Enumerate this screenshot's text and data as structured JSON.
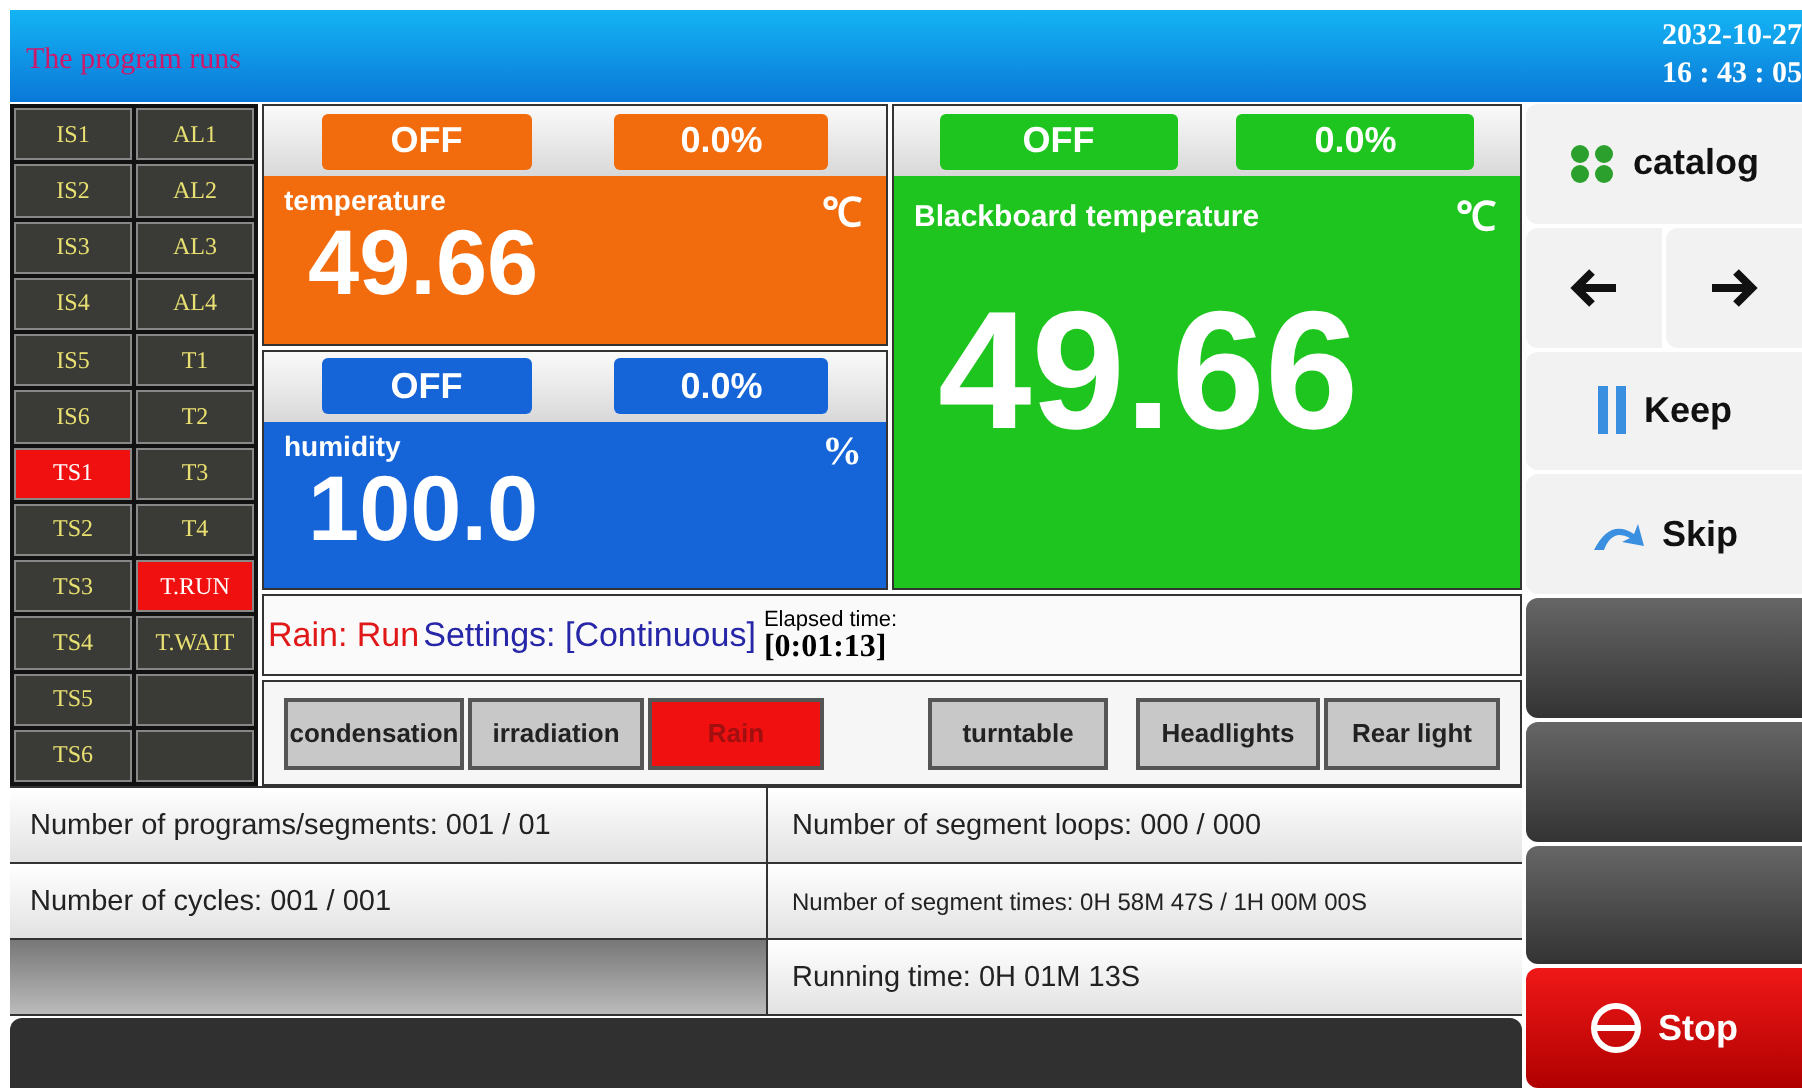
{
  "header": {
    "title": "The program runs",
    "date": "2032-10-27",
    "time": "16 : 43 : 05"
  },
  "indicators": [
    {
      "label": "IS1",
      "active": false
    },
    {
      "label": "AL1",
      "active": false
    },
    {
      "label": "IS2",
      "active": false
    },
    {
      "label": "AL2",
      "active": false
    },
    {
      "label": "IS3",
      "active": false
    },
    {
      "label": "AL3",
      "active": false
    },
    {
      "label": "IS4",
      "active": false
    },
    {
      "label": "AL4",
      "active": false
    },
    {
      "label": "IS5",
      "active": false
    },
    {
      "label": "T1",
      "active": false
    },
    {
      "label": "IS6",
      "active": false
    },
    {
      "label": "T2",
      "active": false
    },
    {
      "label": "TS1",
      "active": true
    },
    {
      "label": "T3",
      "active": false
    },
    {
      "label": "TS2",
      "active": false
    },
    {
      "label": "T4",
      "active": false
    },
    {
      "label": "TS3",
      "active": false
    },
    {
      "label": "T.RUN",
      "active": true
    },
    {
      "label": "TS4",
      "active": false
    },
    {
      "label": "T.WAIT",
      "active": false
    },
    {
      "label": "TS5",
      "active": false
    },
    {
      "active": false
    },
    {
      "label": "TS6",
      "active": false
    },
    {
      "active": false
    }
  ],
  "panels": [
    {
      "kind": "small",
      "label": "temperature",
      "unit": "℃",
      "value": "49.66",
      "status": "OFF",
      "output": "0.0%",
      "color": "#f26b0c"
    },
    {
      "kind": "small",
      "label": "humidity",
      "unit": "%",
      "value": "100.0",
      "status": "OFF",
      "output": "0.0%",
      "color": "#1565d8"
    },
    {
      "kind": "large",
      "label": "Blackboard temperature",
      "unit": "℃",
      "value": "49.66",
      "status": "OFF",
      "output": "0.0%",
      "color": "#1ec51e"
    }
  ],
  "status_line": {
    "state": "Rain: Run",
    "settings": "Settings: [Continuous]",
    "elapsed_label": "Elapsed time:",
    "elapsed": "[0:01:13]"
  },
  "functions": [
    {
      "kind": "button",
      "label": "condensation",
      "on": false
    },
    {
      "kind": "button",
      "label": "irradiation",
      "on": false
    },
    {
      "kind": "button",
      "label": "Rain",
      "on": true
    },
    {
      "kind": "blank"
    },
    {
      "kind": "button",
      "label": "turntable",
      "on": false
    },
    {
      "kind": "blank"
    },
    {
      "kind": "button",
      "label": "Headlights",
      "on": false
    },
    {
      "kind": "button",
      "label": "Rear light",
      "on": false
    }
  ],
  "info": [
    {
      "text": "Number of programs/segments: 001 / 01"
    },
    {
      "text": "Number of segment loops: 000 / 000"
    },
    {
      "text": "Number of cycles: 001 / 001"
    },
    {
      "text": "Number of segment times: 0H 58M 47S / 1H 00M 00S",
      "kind": "small"
    },
    {
      "kind": "empty"
    },
    {
      "text": "Running time: 0H 01M 13S"
    }
  ],
  "side_buttons": [
    {
      "kind": "catalog",
      "label": "catalog"
    },
    {
      "kind": "nav"
    },
    {
      "kind": "pause",
      "label": "Keep"
    },
    {
      "kind": "skip",
      "label": "Skip"
    },
    {
      "kind": "blank"
    },
    {
      "kind": "blank"
    },
    {
      "kind": "blank"
    },
    {
      "kind": "stop",
      "label": "Stop"
    }
  ]
}
